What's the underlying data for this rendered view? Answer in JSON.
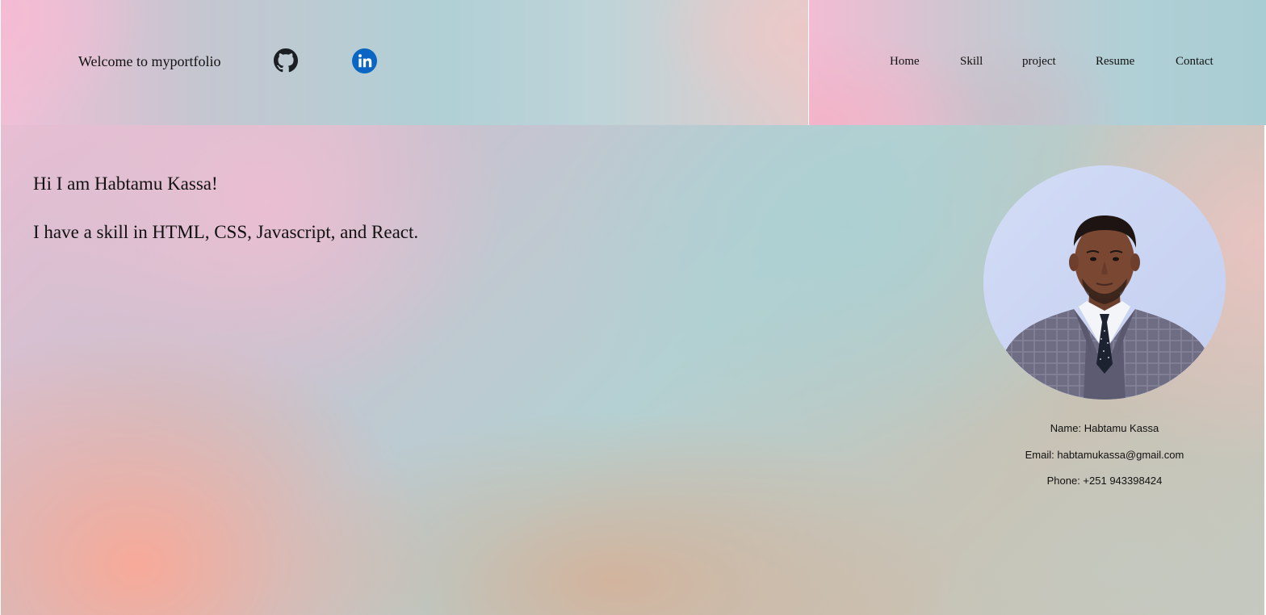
{
  "header": {
    "welcome": "Welcome to myportfolio",
    "social": [
      {
        "icon": "github-icon"
      },
      {
        "icon": "linkedin-icon"
      }
    ],
    "nav": [
      "Home",
      "Skill",
      "project",
      "Resume",
      "Contact"
    ]
  },
  "intro": {
    "greeting": "Hi I am Habtamu Kassa!",
    "skills": "I have a skill in HTML, CSS, Javascript, and React."
  },
  "profile": {
    "name": "Name: Habtamu Kassa",
    "email": "Email: habtamukassa@gmail.com",
    "phone": "Phone: +251 943398424"
  },
  "colors": {
    "linkedin_blue": "#0a66c2",
    "github_black": "#1b1f23"
  }
}
